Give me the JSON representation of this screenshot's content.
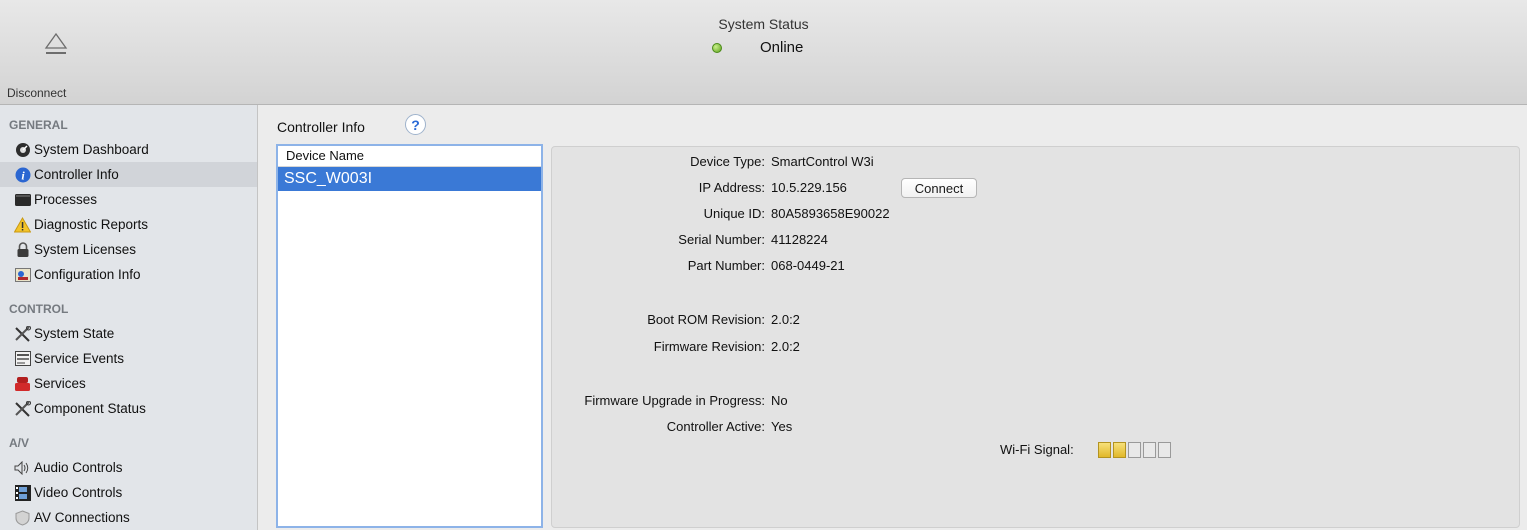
{
  "toolbar": {
    "disconnect_label": "Disconnect",
    "status_title": "System Status",
    "status_text": "Online",
    "status_color": "#5fa21e"
  },
  "sidebar": {
    "sections": [
      {
        "title": "GENERAL",
        "items": [
          {
            "label": "System Dashboard",
            "icon": "gauge-icon"
          },
          {
            "label": "Controller Info",
            "icon": "info-icon",
            "selected": true
          },
          {
            "label": "Processes",
            "icon": "processes-icon"
          },
          {
            "label": "Diagnostic Reports",
            "icon": "warning-icon"
          },
          {
            "label": "System Licenses",
            "icon": "lock-icon"
          },
          {
            "label": "Configuration Info",
            "icon": "configuration-icon"
          }
        ]
      },
      {
        "title": "CONTROL",
        "items": [
          {
            "label": "System State",
            "icon": "tools-icon"
          },
          {
            "label": "Service Events",
            "icon": "events-icon"
          },
          {
            "label": "Services",
            "icon": "services-icon"
          },
          {
            "label": "Component Status",
            "icon": "tools-icon"
          }
        ]
      },
      {
        "title": "A/V",
        "items": [
          {
            "label": "Audio Controls",
            "icon": "speaker-icon"
          },
          {
            "label": "Video Controls",
            "icon": "film-icon"
          },
          {
            "label": "AV Connections",
            "icon": "shield-icon"
          }
        ]
      }
    ]
  },
  "content": {
    "title": "Controller Info",
    "help_glyph": "?",
    "list": {
      "header": "Device Name",
      "rows": [
        "SSC_W003I"
      ]
    },
    "details": {
      "device_type": {
        "label": "Device Type:",
        "value": "SmartControl W3i"
      },
      "ip_address": {
        "label": "IP Address:",
        "value": "10.5.229.156"
      },
      "unique_id": {
        "label": "Unique ID:",
        "value": "80A5893658E90022"
      },
      "serial_number": {
        "label": "Serial Number:",
        "value": "41128224"
      },
      "part_number": {
        "label": "Part Number:",
        "value": "068-0449-21"
      },
      "boot_rom": {
        "label": "Boot ROM Revision:",
        "value": "2.0:2"
      },
      "firmware": {
        "label": "Firmware Revision:",
        "value": "2.0:2"
      },
      "upgrade": {
        "label": "Firmware Upgrade in Progress:",
        "value": "No"
      },
      "active": {
        "label": "Controller Active:",
        "value": "Yes"
      }
    },
    "connect_label": "Connect",
    "wifi": {
      "label": "Wi-Fi Signal:",
      "level": 2,
      "max": 5,
      "color": "#e1b82a"
    }
  }
}
